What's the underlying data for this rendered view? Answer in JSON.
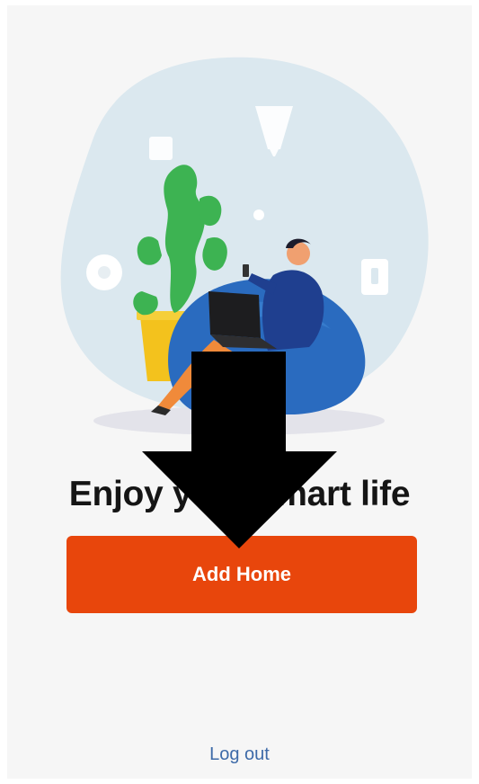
{
  "headline": "Enjoy your smart life",
  "add_home_button": "Add Home",
  "logout_link": "Log out",
  "colors": {
    "accent": "#e8460c",
    "link": "#3d6aa8",
    "background": "#f6f6f6"
  },
  "illustration": {
    "subject": "person-on-beanbag-with-laptop",
    "icons": [
      "lamp-icon",
      "plant-icon",
      "switch-icon",
      "sensor-icon",
      "disc-icon",
      "arrow-down-icon"
    ]
  }
}
